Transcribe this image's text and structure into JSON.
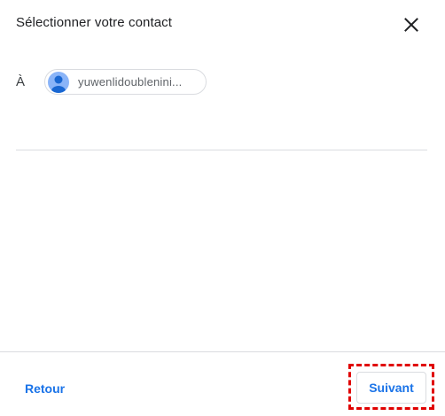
{
  "dialog": {
    "title": "Sélectionner votre contact",
    "close_icon": "close-icon"
  },
  "recipient": {
    "to_label": "À",
    "chip": {
      "name": "yuwenlidoublenini...",
      "avatar_icon": "person-icon"
    }
  },
  "footer": {
    "back_label": "Retour",
    "next_label": "Suivant"
  },
  "colors": {
    "accent": "#1a73e8",
    "avatar": "#8ab4f8",
    "divider": "#dadce0",
    "highlight": "#e00000"
  }
}
